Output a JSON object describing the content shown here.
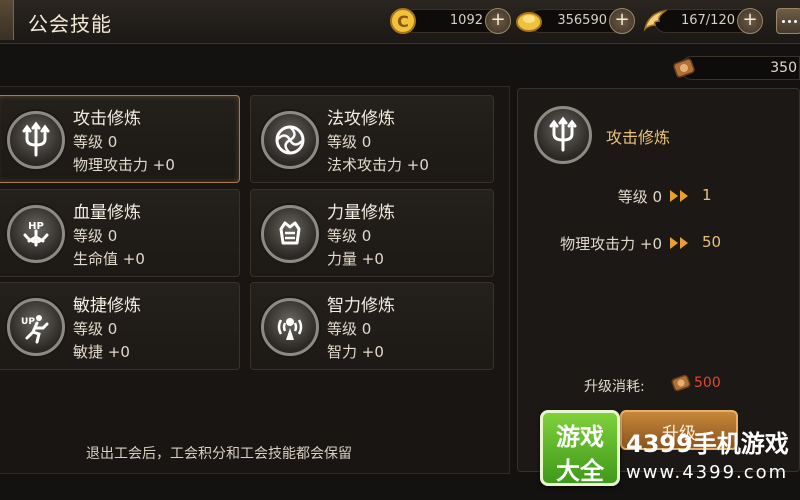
{
  "header": {
    "title": "公会技能",
    "resources": [
      {
        "icon": "coin-c-icon",
        "value": "1092"
      },
      {
        "icon": "gold-ingot-icon",
        "value": "356590"
      },
      {
        "icon": "stamina-wing-icon",
        "value": "167/120"
      }
    ]
  },
  "guild_points": {
    "icon": "guild-token-icon",
    "value": "350"
  },
  "skills": [
    {
      "name": "攻击修炼",
      "level": "等级 0",
      "stat": "物理攻击力 +0",
      "icon": "trident-icon",
      "selected": true
    },
    {
      "name": "法攻修炼",
      "level": "等级 0",
      "stat": "法术攻击力 +0",
      "icon": "magic-swirl-icon"
    },
    {
      "name": "血量修炼",
      "level": "等级 0",
      "stat": "生命值 +0",
      "icon": "hp-icon"
    },
    {
      "name": "力量修炼",
      "level": "等级 0",
      "stat": "力量 +0",
      "icon": "fist-icon"
    },
    {
      "name": "敏捷修炼",
      "level": "等级 0",
      "stat": "敏捷 +0",
      "icon": "runner-icon"
    },
    {
      "name": "智力修炼",
      "level": "等级 0",
      "stat": "智力 +0",
      "icon": "mind-icon"
    }
  ],
  "footer_note": "退出工会后，工会积分和工会技能都会保留",
  "detail": {
    "name": "攻击修炼",
    "level_label": "等级 0",
    "level_next": "1",
    "stat_label": "物理攻击力 +0",
    "stat_next": "50",
    "upgrade_cost_label": "升级消耗:",
    "upgrade_cost_value": "500",
    "upgrade_button": "升级"
  },
  "watermark": {
    "logo_line1": "游戏",
    "logo_line2": "大全",
    "text1": "4399手机游戏",
    "text2": "www.4399.com"
  },
  "colors": {
    "accent_gold": "#e8c27a",
    "cost_red": "#e04830",
    "selected_border": "#a87c48"
  }
}
